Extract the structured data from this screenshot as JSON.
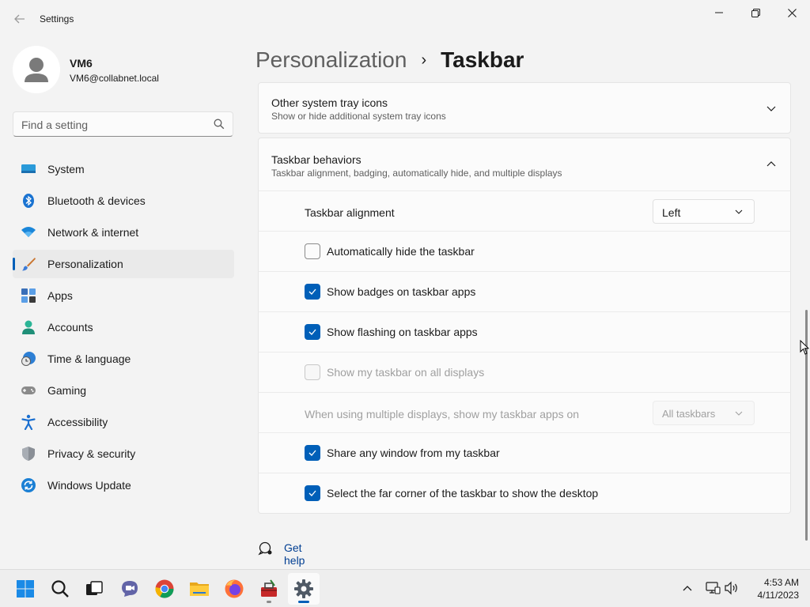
{
  "window": {
    "title": "Settings"
  },
  "profile": {
    "name": "VM6",
    "email": "VM6@collabnet.local"
  },
  "search": {
    "placeholder": "Find a setting"
  },
  "sidebar": {
    "items": [
      {
        "label": "System",
        "icon": "system-icon"
      },
      {
        "label": "Bluetooth & devices",
        "icon": "bluetooth-icon"
      },
      {
        "label": "Network & internet",
        "icon": "wifi-icon"
      },
      {
        "label": "Personalization",
        "icon": "brush-icon",
        "active": true
      },
      {
        "label": "Apps",
        "icon": "apps-icon"
      },
      {
        "label": "Accounts",
        "icon": "accounts-icon"
      },
      {
        "label": "Time & language",
        "icon": "clock-globe-icon"
      },
      {
        "label": "Gaming",
        "icon": "gamepad-icon"
      },
      {
        "label": "Accessibility",
        "icon": "accessibility-icon"
      },
      {
        "label": "Privacy & security",
        "icon": "shield-icon"
      },
      {
        "label": "Windows Update",
        "icon": "update-icon"
      }
    ]
  },
  "breadcrumb": {
    "parent": "Personalization",
    "separator": "›",
    "current": "Taskbar"
  },
  "sections": {
    "tray": {
      "title": "Other system tray icons",
      "subtitle": "Show or hide additional system tray icons"
    },
    "behaviors": {
      "title": "Taskbar behaviors",
      "subtitle": "Taskbar alignment, badging, automatically hide, and multiple displays"
    }
  },
  "settings": {
    "alignment": {
      "label": "Taskbar alignment",
      "value": "Left"
    },
    "auto_hide": {
      "label": "Automatically hide the taskbar",
      "checked": false
    },
    "badges": {
      "label": "Show badges on taskbar apps",
      "checked": true
    },
    "flashing": {
      "label": "Show flashing on taskbar apps",
      "checked": true
    },
    "all_displays": {
      "label": "Show my taskbar on all displays",
      "checked": false,
      "disabled": true
    },
    "multi_display": {
      "label": "When using multiple displays, show my taskbar apps on",
      "value": "All taskbars",
      "disabled": true
    },
    "share_window": {
      "label": "Share any window from my taskbar",
      "checked": true
    },
    "far_corner": {
      "label": "Select the far corner of the taskbar to show the desktop",
      "checked": true
    }
  },
  "help": {
    "label": "Get help"
  },
  "taskbar": {
    "apps": [
      "start-icon",
      "search-icon",
      "task-view-icon",
      "teams-chat-icon",
      "chrome-icon",
      "file-explorer-icon",
      "firefox-icon",
      "toolbox-icon",
      "settings-icon"
    ],
    "time": "4:53 AM",
    "date": "4/11/2023"
  },
  "colors": {
    "accent": "#005fb8",
    "background": "#f3f3f3",
    "card": "#fbfbfb"
  }
}
